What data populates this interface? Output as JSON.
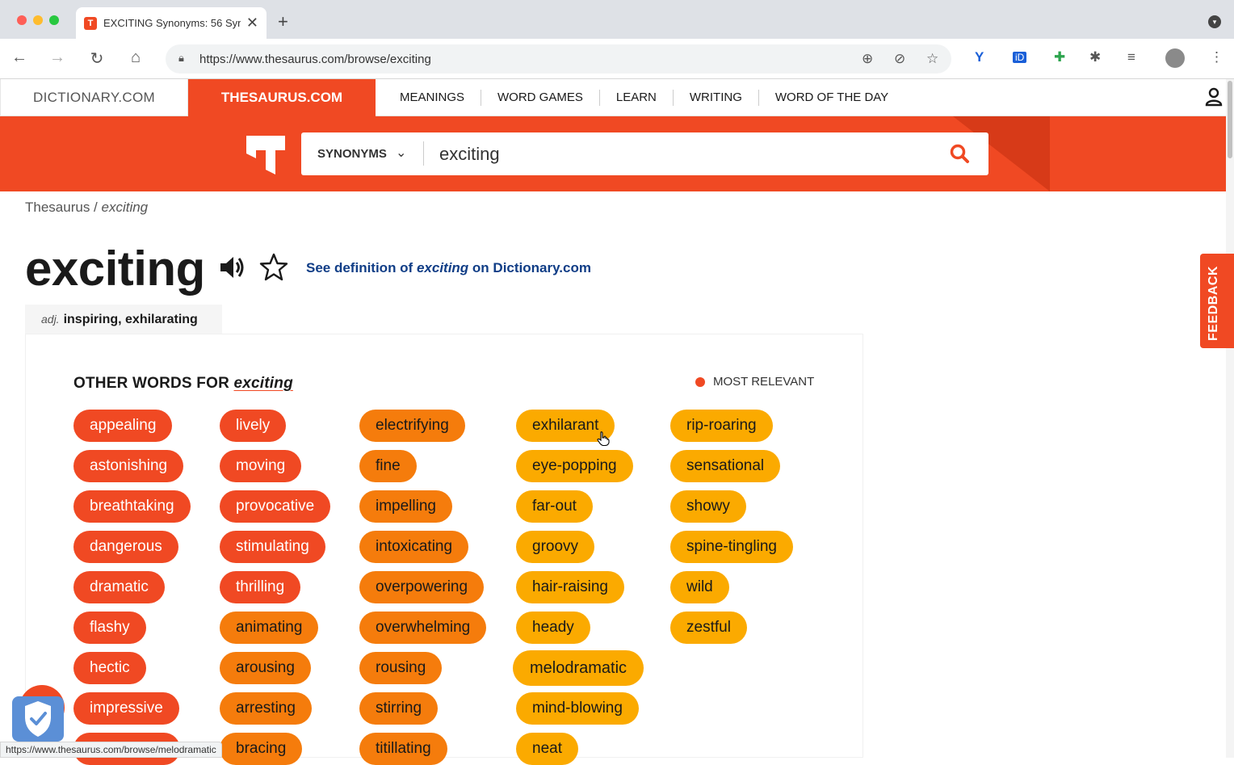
{
  "browser": {
    "tab_title": "EXCITING Synonyms: 56 Syn",
    "url": "https://www.thesaurus.com/browse/exciting",
    "status_url": "https://www.thesaurus.com/browse/melodramatic"
  },
  "site_nav": {
    "dictionary": "DICTIONARY.COM",
    "thesaurus": "THESAURUS.COM",
    "links": [
      "MEANINGS",
      "WORD GAMES",
      "LEARN",
      "WRITING",
      "WORD OF THE DAY"
    ]
  },
  "search": {
    "mode": "SYNONYMS",
    "query": "exciting"
  },
  "breadcrumb": {
    "root": "Thesaurus",
    "sep": " / ",
    "current": "exciting"
  },
  "entry": {
    "word": "exciting",
    "def_prefix": "See definition of ",
    "def_word": "exciting",
    "def_suffix": " on Dictionary.com",
    "pos": "adj.",
    "sense": "inspiring, exhilarating"
  },
  "synonyms": {
    "heading_prefix": "OTHER WORDS FOR ",
    "heading_word": "exciting",
    "relevance_label": "MOST RELEVANT",
    "columns": [
      [
        "appealing",
        "astonishing",
        "breathtaking",
        "dangerous",
        "dramatic",
        "flashy",
        "hectic",
        "impressive"
      ],
      [
        "lively",
        "moving",
        "provocative",
        "stimulating",
        "thrilling",
        "animating",
        "arousing",
        "arresting",
        "bracing"
      ],
      [
        "electrifying",
        "fine",
        "impelling",
        "intoxicating",
        "overpowering",
        "overwhelming",
        "rousing",
        "stirring",
        "titillating"
      ],
      [
        "exhilarant",
        "eye-popping",
        "far-out",
        "groovy",
        "hair-raising",
        "heady",
        "melodramatic",
        "mind-blowing",
        "neat"
      ],
      [
        "rip-roaring",
        "sensational",
        "showy",
        "spine-tingling",
        "wild",
        "zestful"
      ]
    ]
  },
  "feedback": "FEEDBACK",
  "colors": {
    "brand": "#f04923",
    "most_relevant": "#f04923",
    "mid_relevant": "#f57c0c",
    "less_relevant": "#fbaa00"
  }
}
